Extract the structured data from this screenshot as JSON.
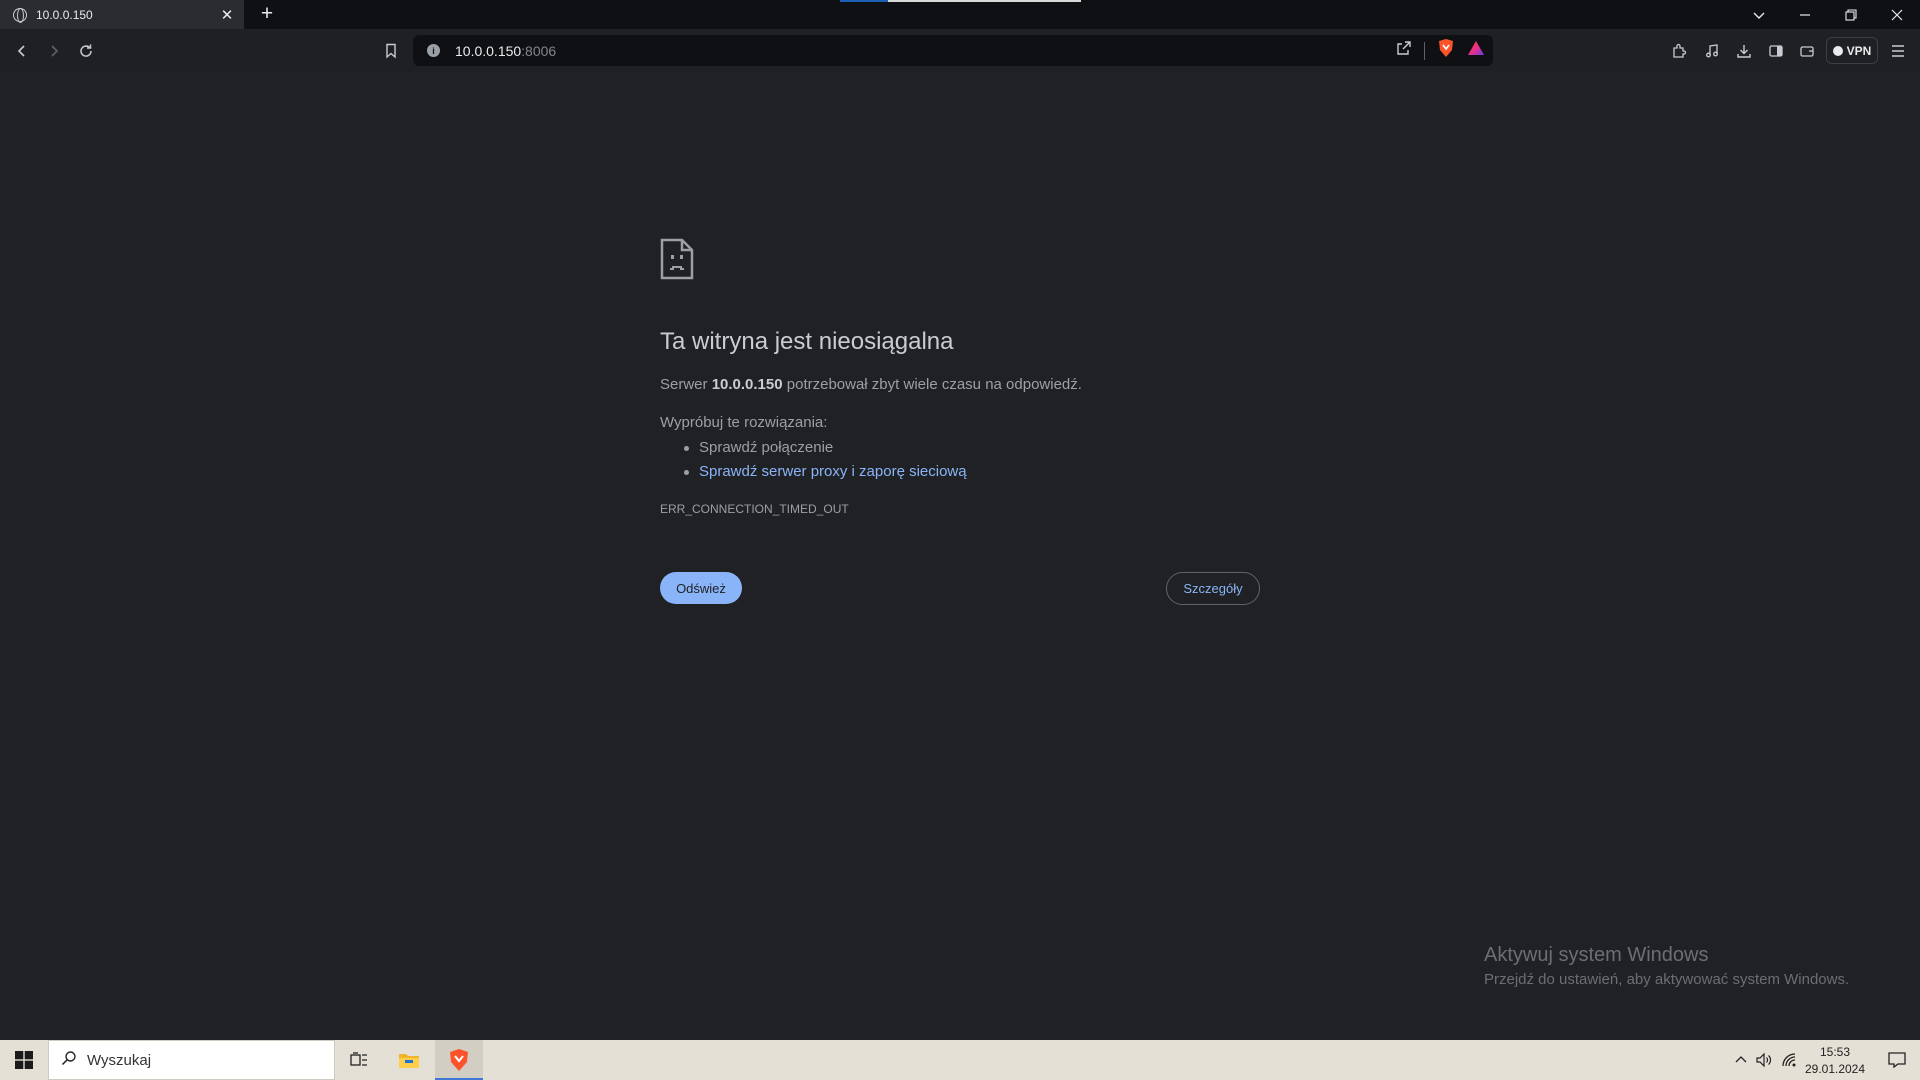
{
  "browser": {
    "tab": {
      "title": "10.0.0.150",
      "favicon": "globe-icon"
    },
    "address": {
      "host": "10.0.0.150",
      "port": ":8006"
    },
    "vpn_label": "VPN"
  },
  "error_page": {
    "title": "Ta witryna jest nieosiągalna",
    "summary_prefix": "Serwer ",
    "summary_host": "10.0.0.150",
    "summary_suffix": " potrzebował zbyt wiele czasu na odpowiedź.",
    "try_heading": "Wypróbuj te rozwiązania:",
    "suggestions": [
      {
        "text": "Sprawdź połączenie",
        "is_link": false
      },
      {
        "text": "Sprawdź serwer proxy i zaporę sieciową",
        "is_link": true
      }
    ],
    "error_code": "ERR_CONNECTION_TIMED_OUT",
    "reload_label": "Odśwież",
    "details_label": "Szczegóły"
  },
  "watermark": {
    "title": "Aktywuj system Windows",
    "subtitle": "Przejdź do ustawień, aby aktywować system Windows."
  },
  "taskbar": {
    "search_placeholder": "Wyszukaj",
    "clock_time": "15:53",
    "clock_date": "29.01.2024"
  },
  "colors": {
    "page_bg": "#202124",
    "link": "#8ab4f8",
    "button_primary": "#8ab4f8"
  }
}
